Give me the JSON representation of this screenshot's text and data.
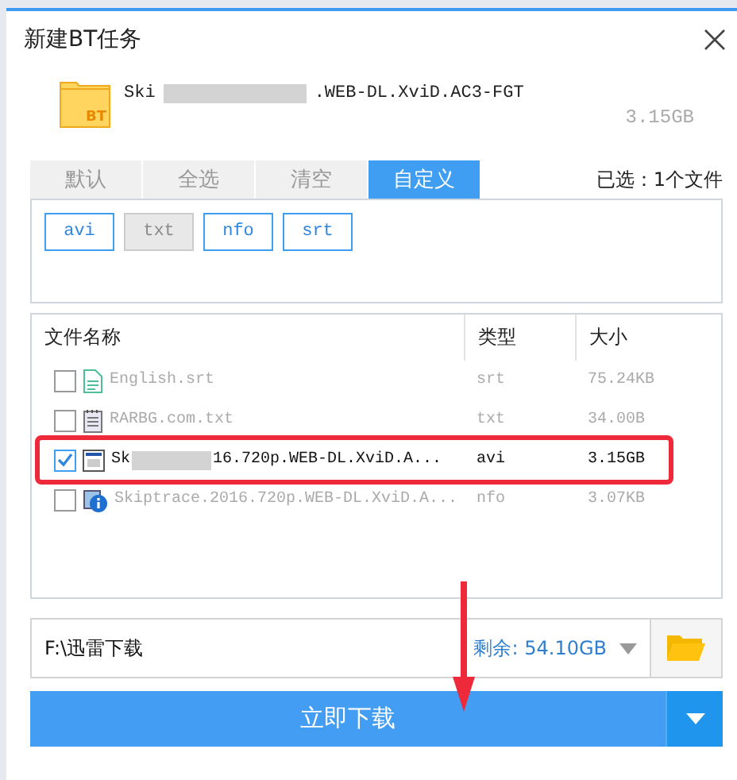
{
  "window": {
    "title": "新建BT任务"
  },
  "torrent": {
    "badge": "BT",
    "name_start": "Ski",
    "name_end": ".WEB-DL.XviD.AC3-FGT",
    "size": "3.15GB"
  },
  "tabs": [
    {
      "label": "默认",
      "selected": false
    },
    {
      "label": "全选",
      "selected": false
    },
    {
      "label": "清空",
      "selected": false
    },
    {
      "label": "自定义",
      "selected": true
    }
  ],
  "selection_summary": "已选：1个文件",
  "filters": [
    {
      "label": "avi",
      "disabled": false
    },
    {
      "label": "txt",
      "disabled": true
    },
    {
      "label": "nfo",
      "disabled": false
    },
    {
      "label": "srt",
      "disabled": false
    }
  ],
  "table": {
    "columns": [
      "文件名称",
      "类型",
      "大小"
    ],
    "rows": [
      {
        "kind": "subtitle",
        "name_start": "English.srt",
        "name_end": "",
        "type": "srt",
        "size": "75.24KB",
        "checked": false,
        "highlighted": false
      },
      {
        "kind": "text",
        "name_start": "RARBG.com.txt",
        "name_end": "",
        "type": "txt",
        "size": "34.00B",
        "checked": false,
        "highlighted": false
      },
      {
        "kind": "video",
        "name_start": "Sk",
        "name_end": "16.720p.WEB-DL.XviD.A...",
        "type": "avi",
        "size": "3.15GB",
        "checked": true,
        "highlighted": true
      },
      {
        "kind": "info",
        "name_start": "Skiptrace.2016.720p.WEB-DL.XviD.A...",
        "name_end": "",
        "type": "nfo",
        "size": "3.07KB",
        "checked": false,
        "highlighted": false
      }
    ]
  },
  "save_path": {
    "value": "F:\\迅雷下载",
    "free_label": "剩余:",
    "free_space": "54.10GB"
  },
  "download_button": "立即下载"
}
